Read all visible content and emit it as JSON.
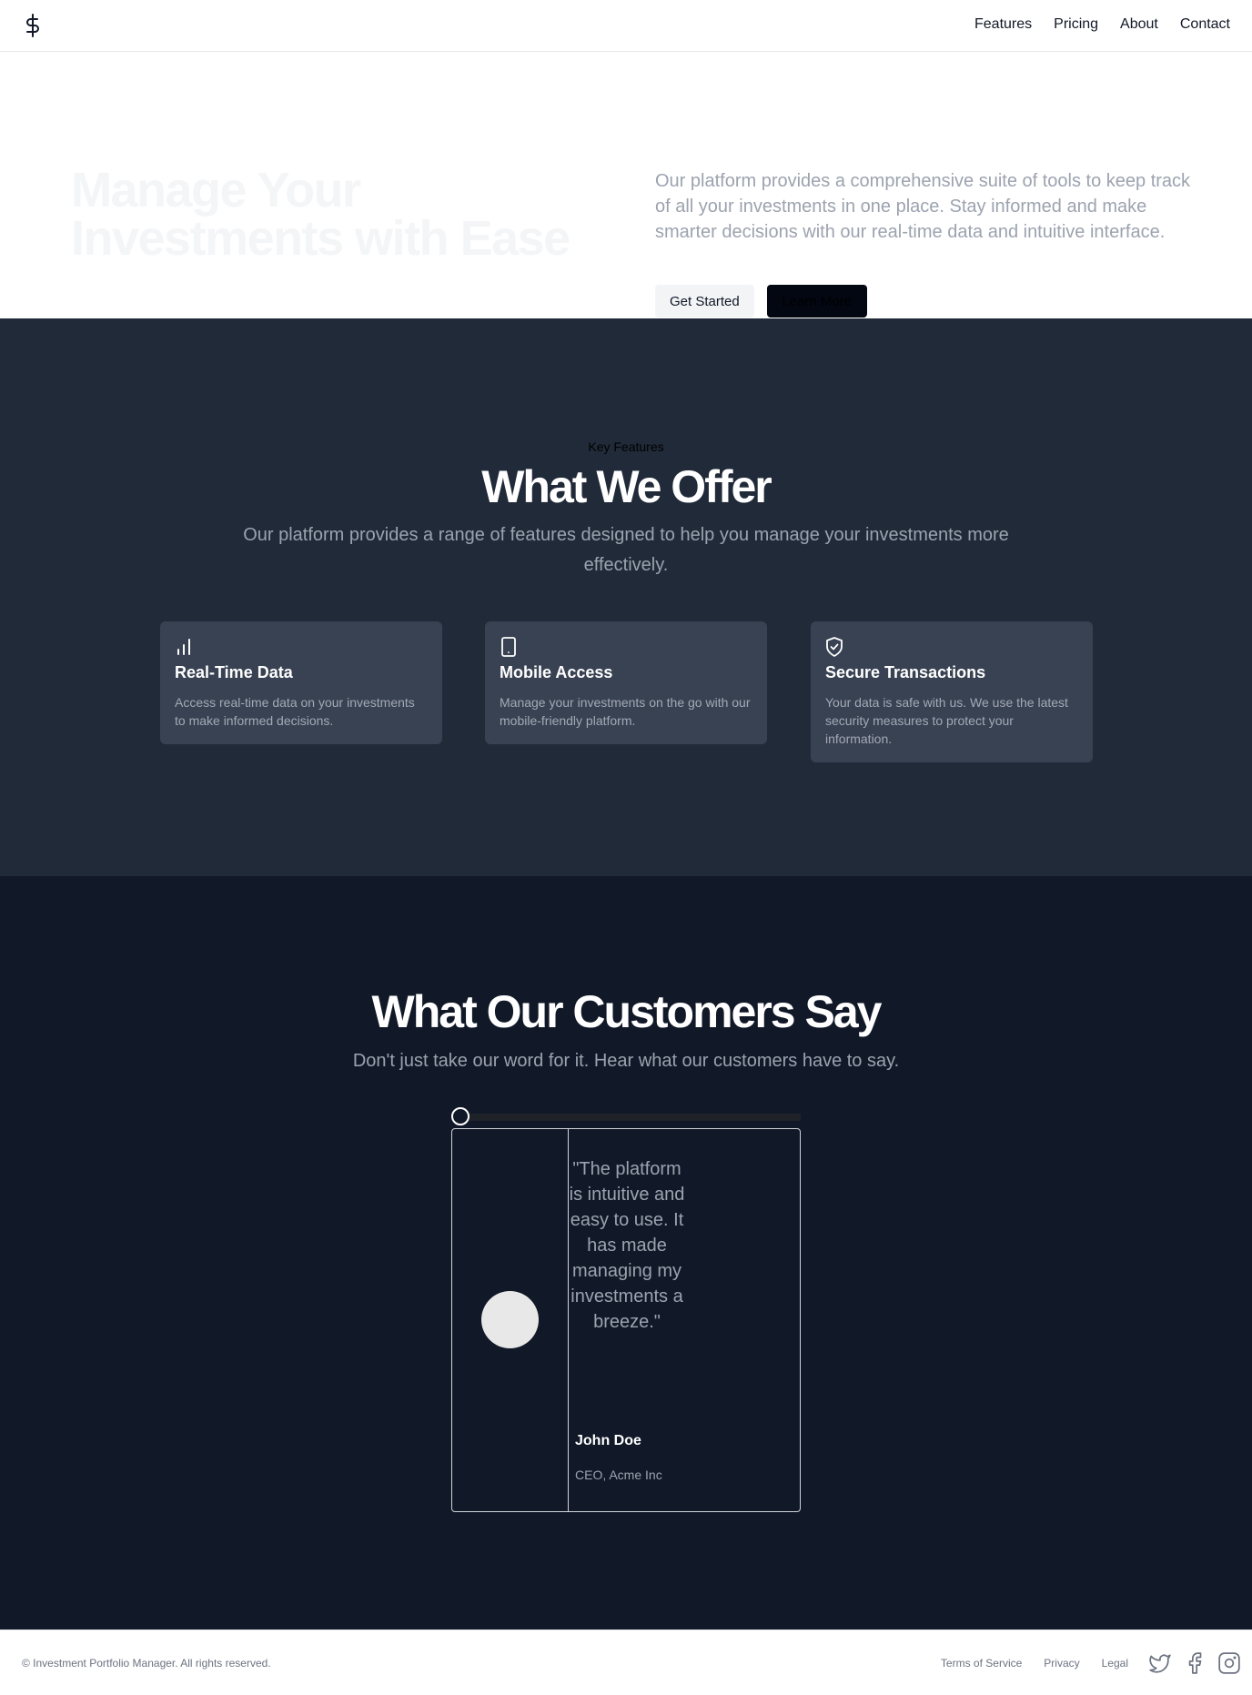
{
  "header": {
    "logo_icon": "dollar-sign-icon",
    "nav": [
      "Features",
      "Pricing",
      "About",
      "Contact"
    ]
  },
  "hero": {
    "title": "Manage Your Investments with Ease",
    "description": "Our platform provides a comprehensive suite of tools to keep track of all your investments in one place. Stay informed and make smarter decisions with our real-time data and intuitive interface.",
    "primary_button": "Get Started",
    "secondary_button": "Learn More"
  },
  "features": {
    "eyebrow": "Key Features",
    "title": "What We Offer",
    "subtitle": "Our platform provides a range of features designed to help you manage your investments more effectively.",
    "cards": [
      {
        "icon": "bar-chart-icon",
        "title": "Real-Time Data",
        "text": "Access real-time data on your investments to make informed decisions."
      },
      {
        "icon": "tablet-icon",
        "title": "Mobile Access",
        "text": "Manage your investments on the go with our mobile-friendly platform."
      },
      {
        "icon": "shield-check-icon",
        "title": "Secure Transactions",
        "text": "Your data is safe with us. We use the latest security measures to protect your information."
      }
    ]
  },
  "testimonials": {
    "title": "What Our Customers Say",
    "subtitle": "Don't just take our word for it. Hear what our customers have to say.",
    "slider_position": 0,
    "items": [
      {
        "quote": "\"The platform is intuitive and easy to use. It has made managing my investments a breeze.\"",
        "name": "John Doe",
        "role": "CEO, Acme Inc"
      }
    ]
  },
  "footer": {
    "copyright": "© Investment Portfolio Manager. All rights reserved.",
    "links": [
      "Terms of Service",
      "Privacy",
      "Legal"
    ],
    "social_icons": [
      "twitter-icon",
      "facebook-icon",
      "instagram-icon"
    ]
  },
  "colors": {
    "features_bg": "#212a39",
    "card_bg": "#394253",
    "testimonials_bg": "#111827"
  }
}
